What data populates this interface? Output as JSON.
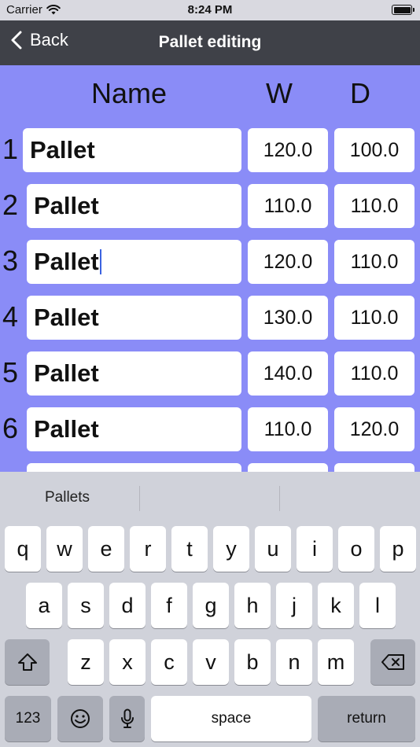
{
  "status": {
    "carrier": "Carrier",
    "time": "8:24 PM"
  },
  "nav": {
    "back_label": "Back",
    "title": "Pallet editing"
  },
  "columns": {
    "name": "Name",
    "w": "W",
    "d": "D"
  },
  "rows": [
    {
      "index": "1",
      "name": "Pallet",
      "w": "120.0",
      "d": "100.0"
    },
    {
      "index": "2",
      "name": "Pallet",
      "w": "110.0",
      "d": "110.0"
    },
    {
      "index": "3",
      "name": "Pallet",
      "w": "120.0",
      "d": "110.0"
    },
    {
      "index": "4",
      "name": "Pallet",
      "w": "130.0",
      "d": "110.0"
    },
    {
      "index": "5",
      "name": "Pallet",
      "w": "140.0",
      "d": "110.0"
    },
    {
      "index": "6",
      "name": "Pallet",
      "w": "110.0",
      "d": "120.0"
    }
  ],
  "keyboard": {
    "suggestion": "Pallets",
    "row1": [
      "q",
      "w",
      "e",
      "r",
      "t",
      "y",
      "u",
      "i",
      "o",
      "p"
    ],
    "row2": [
      "a",
      "s",
      "d",
      "f",
      "g",
      "h",
      "j",
      "k",
      "l"
    ],
    "row3": [
      "z",
      "x",
      "c",
      "v",
      "b",
      "n",
      "m"
    ],
    "numbers_label": "123",
    "space_label": "space",
    "return_label": "return"
  },
  "colors": {
    "background": "#8a8cf7",
    "navbar": "#3f4148",
    "caret": "#3b63e0"
  }
}
